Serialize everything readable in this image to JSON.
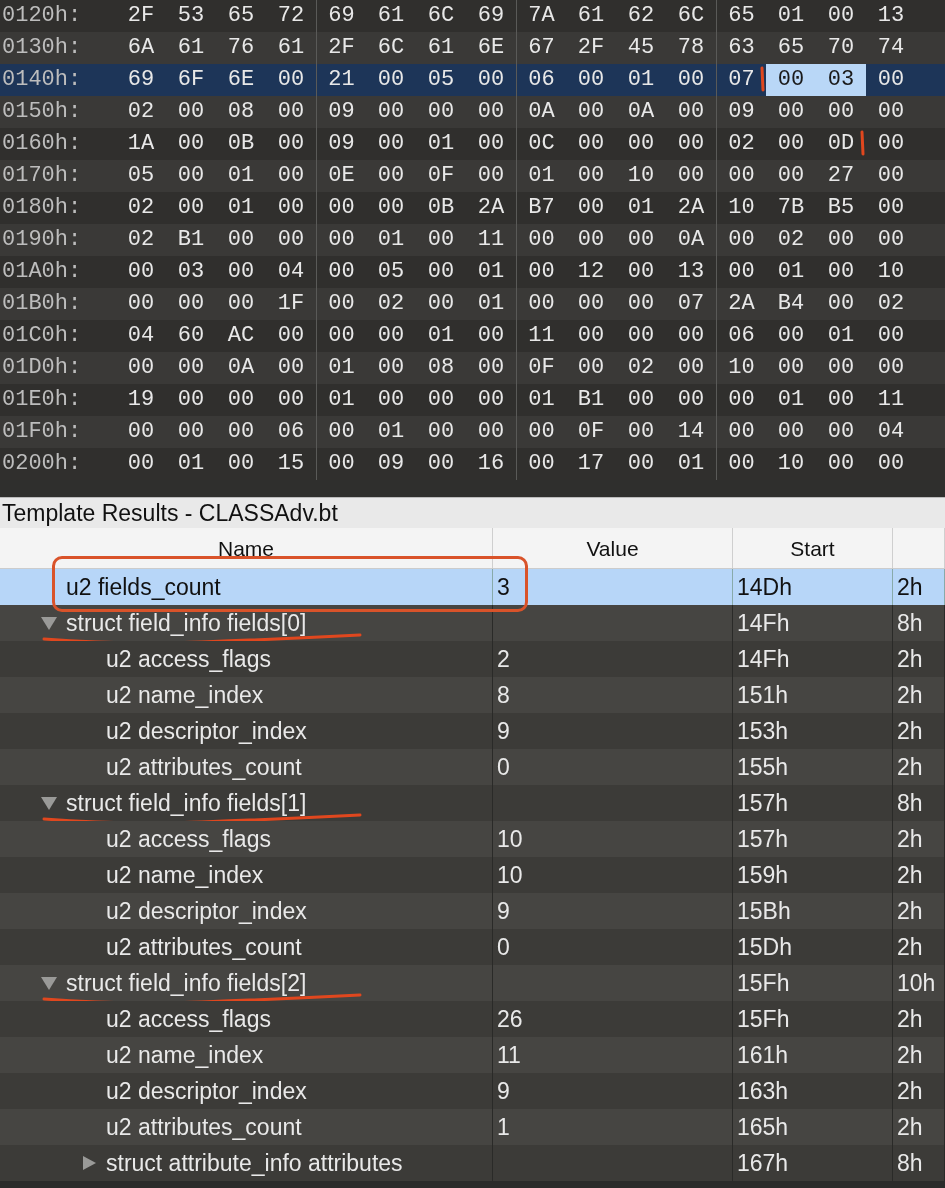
{
  "hex_view": {
    "rows": [
      {
        "offset": "0120h:",
        "bytes": [
          "2F",
          "53",
          "65",
          "72",
          "69",
          "61",
          "6C",
          "69",
          "7A",
          "61",
          "62",
          "6C",
          "65",
          "01",
          "00",
          "13"
        ],
        "selected": false
      },
      {
        "offset": "0130h:",
        "bytes": [
          "6A",
          "61",
          "76",
          "61",
          "2F",
          "6C",
          "61",
          "6E",
          "67",
          "2F",
          "45",
          "78",
          "63",
          "65",
          "70",
          "74"
        ],
        "selected": false
      },
      {
        "offset": "0140h:",
        "bytes": [
          "69",
          "6F",
          "6E",
          "00",
          "21",
          "00",
          "05",
          "00",
          "06",
          "00",
          "01",
          "00",
          "07",
          "00",
          "03",
          "00"
        ],
        "selected": true,
        "selected_bytes": [
          false,
          false,
          false,
          false,
          false,
          false,
          false,
          false,
          false,
          false,
          false,
          false,
          false,
          true,
          true,
          false
        ],
        "ticked_bytes": [
          false,
          false,
          false,
          false,
          false,
          false,
          false,
          false,
          false,
          false,
          false,
          false,
          false,
          true,
          false,
          false
        ]
      },
      {
        "offset": "0150h:",
        "bytes": [
          "02",
          "00",
          "08",
          "00",
          "09",
          "00",
          "00",
          "00",
          "0A",
          "00",
          "0A",
          "00",
          "09",
          "00",
          "00",
          "00"
        ],
        "selected": false
      },
      {
        "offset": "0160h:",
        "bytes": [
          "1A",
          "00",
          "0B",
          "00",
          "09",
          "00",
          "01",
          "00",
          "0C",
          "00",
          "00",
          "00",
          "02",
          "00",
          "0D",
          "00"
        ],
        "selected": false,
        "ticked_bytes": [
          false,
          false,
          false,
          false,
          false,
          false,
          false,
          false,
          false,
          false,
          false,
          false,
          false,
          false,
          false,
          true
        ]
      },
      {
        "offset": "0170h:",
        "bytes": [
          "05",
          "00",
          "01",
          "00",
          "0E",
          "00",
          "0F",
          "00",
          "01",
          "00",
          "10",
          "00",
          "00",
          "00",
          "27",
          "00"
        ],
        "selected": false
      },
      {
        "offset": "0180h:",
        "bytes": [
          "02",
          "00",
          "01",
          "00",
          "00",
          "00",
          "0B",
          "2A",
          "B7",
          "00",
          "01",
          "2A",
          "10",
          "7B",
          "B5",
          "00"
        ],
        "selected": false
      },
      {
        "offset": "0190h:",
        "bytes": [
          "02",
          "B1",
          "00",
          "00",
          "00",
          "01",
          "00",
          "11",
          "00",
          "00",
          "00",
          "0A",
          "00",
          "02",
          "00",
          "00"
        ],
        "selected": false
      },
      {
        "offset": "01A0h:",
        "bytes": [
          "00",
          "03",
          "00",
          "04",
          "00",
          "05",
          "00",
          "01",
          "00",
          "12",
          "00",
          "13",
          "00",
          "01",
          "00",
          "10"
        ],
        "selected": false
      },
      {
        "offset": "01B0h:",
        "bytes": [
          "00",
          "00",
          "00",
          "1F",
          "00",
          "02",
          "00",
          "01",
          "00",
          "00",
          "00",
          "07",
          "2A",
          "B4",
          "00",
          "02"
        ],
        "selected": false
      },
      {
        "offset": "01C0h:",
        "bytes": [
          "04",
          "60",
          "AC",
          "00",
          "00",
          "00",
          "01",
          "00",
          "11",
          "00",
          "00",
          "00",
          "06",
          "00",
          "01",
          "00"
        ],
        "selected": false
      },
      {
        "offset": "01D0h:",
        "bytes": [
          "00",
          "00",
          "0A",
          "00",
          "01",
          "00",
          "08",
          "00",
          "0F",
          "00",
          "02",
          "00",
          "10",
          "00",
          "00",
          "00"
        ],
        "selected": false
      },
      {
        "offset": "01E0h:",
        "bytes": [
          "19",
          "00",
          "00",
          "00",
          "01",
          "00",
          "00",
          "00",
          "01",
          "B1",
          "00",
          "00",
          "00",
          "01",
          "00",
          "11"
        ],
        "selected": false
      },
      {
        "offset": "01F0h:",
        "bytes": [
          "00",
          "00",
          "00",
          "06",
          "00",
          "01",
          "00",
          "00",
          "00",
          "0F",
          "00",
          "14",
          "00",
          "00",
          "00",
          "04"
        ],
        "selected": false
      },
      {
        "offset": "0200h:",
        "bytes": [
          "00",
          "01",
          "00",
          "15",
          "00",
          "09",
          "00",
          "16",
          "00",
          "17",
          "00",
          "01",
          "00",
          "10",
          "00",
          "00"
        ],
        "selected": false
      }
    ]
  },
  "template_results": {
    "title": "Template Results - CLASSAdv.bt",
    "columns": [
      "Name",
      "Value",
      "Start"
    ],
    "rows": [
      {
        "name": "u2 fields_count",
        "value": "3",
        "start": "14Dh",
        "size": "2h",
        "selected": true,
        "boxed": true,
        "underlined": false
      },
      {
        "name": "struct field_info fields[0]",
        "start": "14Fh",
        "size": "8h",
        "selected": false,
        "expanded": true,
        "boxed": false,
        "underlined": true,
        "children": [
          {
            "name": "u2 access_flags",
            "value": "2",
            "start": "14Fh",
            "size": "2h",
            "selected": false
          },
          {
            "name": "u2 name_index",
            "value": "8",
            "start": "151h",
            "size": "2h",
            "selected": false
          },
          {
            "name": "u2 descriptor_index",
            "value": "9",
            "start": "153h",
            "size": "2h",
            "selected": false
          },
          {
            "name": "u2 attributes_count",
            "value": "0",
            "start": "155h",
            "size": "2h",
            "selected": false
          }
        ]
      },
      {
        "name": "struct field_info fields[1]",
        "start": "157h",
        "size": "8h",
        "selected": false,
        "expanded": true,
        "boxed": false,
        "underlined": true,
        "children": [
          {
            "name": "u2 access_flags",
            "value": "10",
            "start": "157h",
            "size": "2h",
            "selected": false
          },
          {
            "name": "u2 name_index",
            "value": "10",
            "start": "159h",
            "size": "2h",
            "selected": false
          },
          {
            "name": "u2 descriptor_index",
            "value": "9",
            "start": "15Bh",
            "size": "2h",
            "selected": false
          },
          {
            "name": "u2 attributes_count",
            "value": "0",
            "start": "15Dh",
            "size": "2h",
            "selected": false
          }
        ]
      },
      {
        "name": "struct field_info fields[2]",
        "start": "15Fh",
        "size": "10h",
        "selected": false,
        "expanded": true,
        "boxed": false,
        "underlined": true,
        "children": [
          {
            "name": "u2 access_flags",
            "value": "26",
            "start": "15Fh",
            "size": "2h",
            "selected": false
          },
          {
            "name": "u2 name_index",
            "value": "11",
            "start": "161h",
            "size": "2h",
            "selected": false
          },
          {
            "name": "u2 descriptor_index",
            "value": "9",
            "start": "163h",
            "size": "2h",
            "selected": false
          },
          {
            "name": "u2 attributes_count",
            "value": "1",
            "start": "165h",
            "size": "2h",
            "selected": false
          },
          {
            "name": "struct attribute_info attributes",
            "start": "167h",
            "size": "8h",
            "selected": false,
            "expanded": false
          }
        ]
      }
    ]
  }
}
